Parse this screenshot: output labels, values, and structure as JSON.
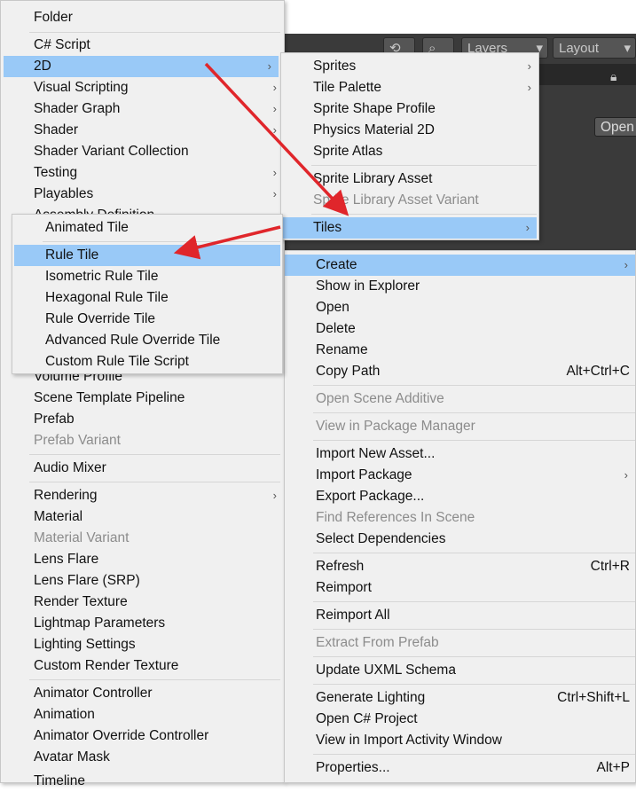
{
  "toolbar": {
    "layers_label": "Layers",
    "layout_label": "Layout",
    "open_label": "Open"
  },
  "menu_main": [
    {
      "label": "Folder"
    },
    {
      "label": "C# Script"
    },
    {
      "label": "2D",
      "submenu": true,
      "highlighted": true
    },
    {
      "label": "Visual Scripting",
      "submenu": true
    },
    {
      "label": "Shader Graph",
      "submenu": true
    },
    {
      "label": "Shader",
      "submenu": true
    },
    {
      "label": "Shader Variant Collection"
    },
    {
      "label": "Testing",
      "submenu": true
    },
    {
      "label": "Playables",
      "submenu": true
    },
    {
      "label": "Assembly Definition"
    },
    {
      "label": "Volume Profile"
    },
    {
      "label": "Scene Template Pipeline"
    },
    {
      "label": "Prefab"
    },
    {
      "label": "Prefab Variant",
      "disabled": true
    },
    {
      "label": "Audio Mixer"
    },
    {
      "label": "Rendering",
      "submenu": true
    },
    {
      "label": "Material"
    },
    {
      "label": "Material Variant",
      "disabled": true
    },
    {
      "label": "Lens Flare"
    },
    {
      "label": "Lens Flare (SRP)"
    },
    {
      "label": "Render Texture"
    },
    {
      "label": "Lightmap Parameters"
    },
    {
      "label": "Lighting Settings"
    },
    {
      "label": "Custom Render Texture"
    },
    {
      "label": "Animator Controller"
    },
    {
      "label": "Animation"
    },
    {
      "label": "Animator Override Controller"
    },
    {
      "label": "Avatar Mask"
    },
    {
      "label": "Timeline"
    }
  ],
  "menu_2d": [
    {
      "label": "Sprites",
      "submenu": true
    },
    {
      "label": "Tile Palette",
      "submenu": true
    },
    {
      "label": "Sprite Shape Profile"
    },
    {
      "label": "Physics Material 2D"
    },
    {
      "label": "Sprite Atlas"
    },
    {
      "label": "Sprite Library Asset"
    },
    {
      "label": "Sprite Library Asset Variant",
      "disabled": true
    },
    {
      "label": "Tiles",
      "submenu": true,
      "highlighted": true
    }
  ],
  "menu_tiles": [
    {
      "label": "Animated Tile"
    },
    {
      "label": "Rule Tile",
      "highlighted": true
    },
    {
      "label": "Isometric Rule Tile"
    },
    {
      "label": "Hexagonal Rule Tile"
    },
    {
      "label": "Rule Override Tile"
    },
    {
      "label": "Advanced Rule Override Tile"
    },
    {
      "label": "Custom Rule Tile Script"
    }
  ],
  "menu_assets": [
    {
      "label": "Create",
      "submenu": true,
      "highlighted": true
    },
    {
      "label": "Show in Explorer"
    },
    {
      "label": "Open"
    },
    {
      "label": "Delete"
    },
    {
      "label": "Rename"
    },
    {
      "label": "Copy Path",
      "shortcut": "Alt+Ctrl+C"
    },
    {
      "label": "Open Scene Additive",
      "disabled": true
    },
    {
      "label": "View in Package Manager",
      "disabled": true
    },
    {
      "label": "Import New Asset..."
    },
    {
      "label": "Import Package",
      "submenu": true
    },
    {
      "label": "Export Package..."
    },
    {
      "label": "Find References In Scene",
      "disabled": true
    },
    {
      "label": "Select Dependencies"
    },
    {
      "label": "Refresh",
      "shortcut": "Ctrl+R"
    },
    {
      "label": "Reimport"
    },
    {
      "label": "Reimport All"
    },
    {
      "label": "Extract From Prefab",
      "disabled": true
    },
    {
      "label": "Update UXML Schema"
    },
    {
      "label": "Generate Lighting",
      "shortcut": "Ctrl+Shift+L"
    },
    {
      "label": "Open C# Project"
    },
    {
      "label": "View in Import Activity Window"
    },
    {
      "label": "Properties...",
      "shortcut": "Alt+P"
    }
  ],
  "colors": {
    "highlight": "#99c9f7",
    "annotation_arrow": "#e0262b",
    "menu_bg": "#f0f0f0",
    "editor_bg": "#3a3a3a"
  }
}
